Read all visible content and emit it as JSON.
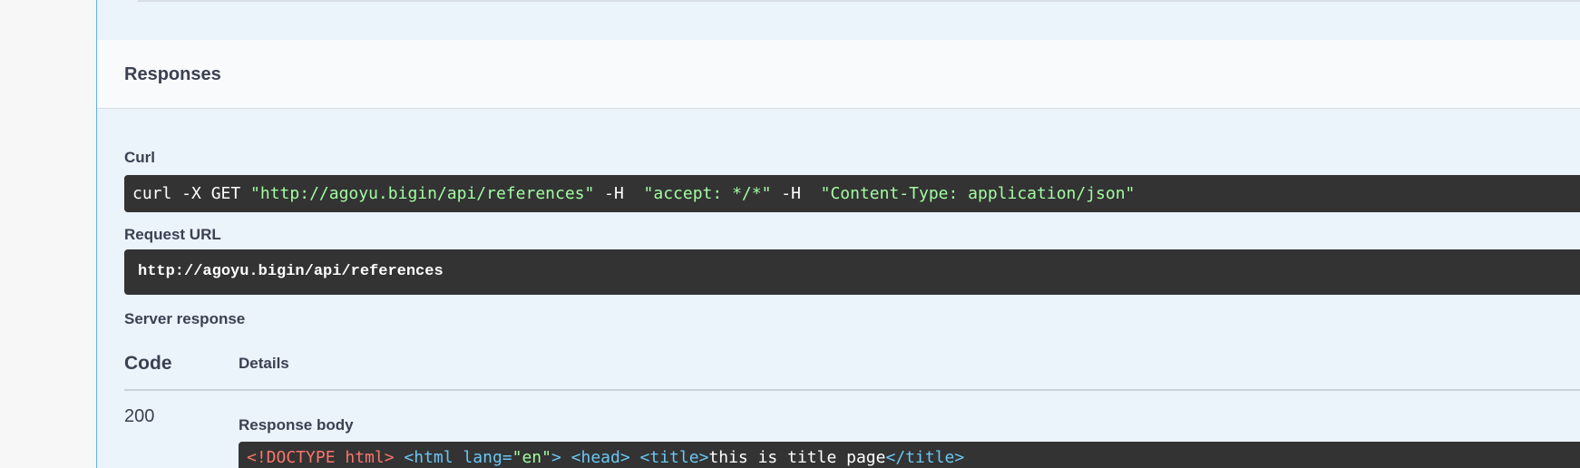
{
  "responses": {
    "title": "Responses"
  },
  "curl": {
    "label": "Curl",
    "cmd_start": "curl -X GET ",
    "url": "\"http://agoyu.bigin/api/references\"",
    "flag1": " -H  ",
    "accept": "\"accept: */*\"",
    "flag2": " -H  ",
    "content_type": "\"Content-Type: application/json\""
  },
  "request_url": {
    "label": "Request URL",
    "value": "http://agoyu.bigin/api/references"
  },
  "server_response": {
    "label": "Server response",
    "col_code": "Code",
    "col_details": "Details",
    "code": "200",
    "body_label": "Response body",
    "body": {
      "doctype": "<!DOCTYPE html>",
      "html_open": "<html lang=",
      "lang_val": "\"en\"",
      "html_close": ">",
      "head": "<head>",
      "title_open": "<title>",
      "title_text": "this is title page",
      "title_close": "</title>"
    }
  },
  "colors": {
    "panel_bg": "#ebf3fb",
    "accent_border": "#61affe",
    "code_bg": "#333333",
    "string_green": "#a2fca2",
    "tag_blue": "#6bc6f2",
    "doctype_red": "#f8756d"
  }
}
